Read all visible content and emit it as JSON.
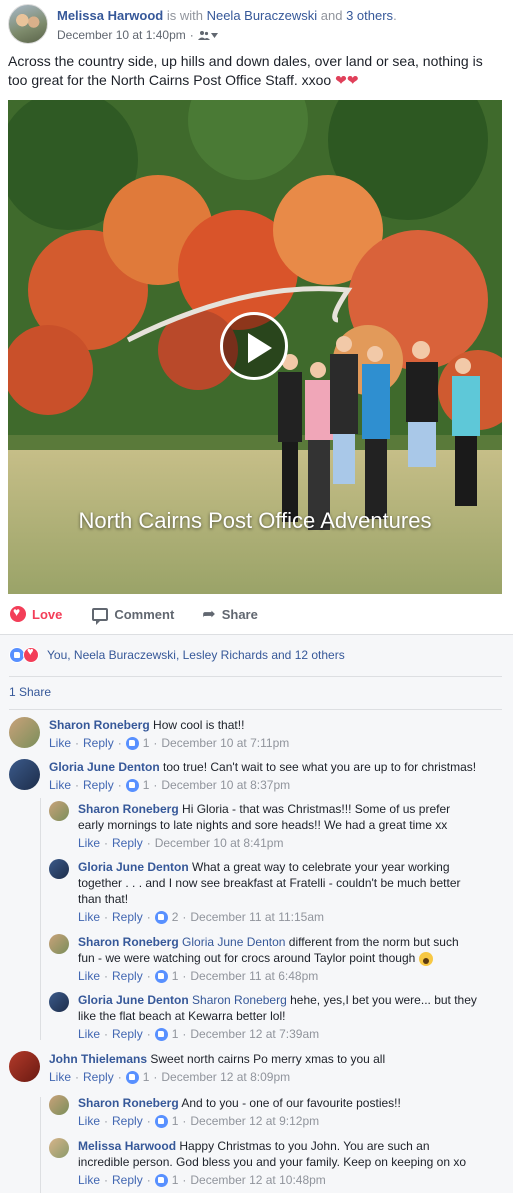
{
  "post": {
    "author": "Melissa Harwood",
    "with_text": "is with",
    "tagged_first": "Neela Buraczewski",
    "and_text": "and",
    "tagged_others": "3 others",
    "suffix": ".",
    "timestamp": "December 10 at 1:40pm",
    "separator": "·",
    "privacy_icon": "friends-icon",
    "text": "Across the country side, up hills and down dales, over land or sea, nothing is too great for the North Cairns Post Office Staff. xxoo",
    "text_hearts": "❤❤",
    "video_caption": "North Cairns Post Office Adventures"
  },
  "actions": {
    "love": "Love",
    "comment": "Comment",
    "share": "Share",
    "love_color": "#f33e58"
  },
  "reactions": {
    "summary": "You, Neela Buraczewski, Lesley Richards and 12 others"
  },
  "shares": {
    "label": "1 Share"
  },
  "meta_labels": {
    "like": "Like",
    "reply": "Reply",
    "dot": "·"
  },
  "comments": [
    {
      "name": "Sharon Roneberg",
      "text": "How cool is that!!",
      "likes": "1",
      "time": "December 10 at 7:11pm"
    },
    {
      "name": "Gloria June Denton",
      "text": "too true! Can't wait to see what you are up to for christmas!",
      "likes": "1",
      "time": "December 10 at 8:37pm"
    },
    {
      "name": "Sharon Roneberg",
      "text": "Hi Gloria - that was Christmas!!! Some of us prefer early mornings to late nights and sore heads!! We had a great time xx",
      "likes": "",
      "time": "December 10 at 8:41pm"
    },
    {
      "name": "Gloria June Denton",
      "text": "What a great way to celebrate your year working together . . . and I now see breakfast at Fratelli - couldn't be much better than that!",
      "likes": "2",
      "time": "December 11 at 11:15am"
    },
    {
      "name": "Sharon Roneberg",
      "mention": "Gloria June Denton",
      "text": "different from the norm but such fun - we were watching out for crocs around Taylor point though",
      "likes": "1",
      "time": "December 11 at 6:48pm"
    },
    {
      "name": "Gloria June Denton",
      "mention": "Sharon Roneberg",
      "text": "hehe, yes,I bet you were... but they like the flat beach at Kewarra better lol!",
      "likes": "1",
      "time": "December 12 at 7:39am"
    },
    {
      "name": "John Thielemans",
      "text": "Sweet north cairns Po merry xmas to you all",
      "likes": "1",
      "time": "December 12 at 8:09pm"
    },
    {
      "name": "Sharon Roneberg",
      "text": "And to you - one of our favourite posties!!",
      "likes": "1",
      "time": "December 12 at 9:12pm"
    },
    {
      "name": "Melissa Harwood",
      "text": "Happy Christmas to you John. You are such an incredible person. God bless you and your family. Keep on keeping on xo",
      "likes": "1",
      "time": "December 12 at 10:48pm"
    }
  ]
}
